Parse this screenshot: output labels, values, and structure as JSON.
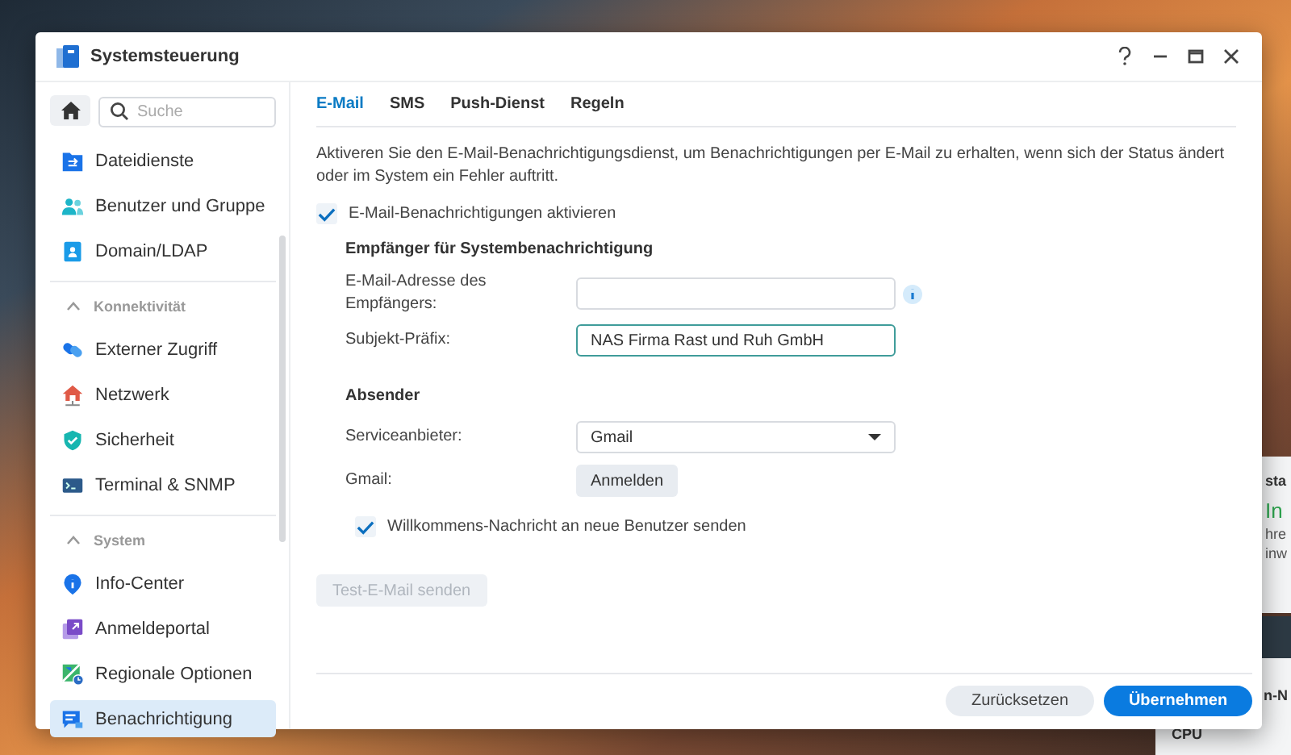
{
  "window": {
    "title": "Systemsteuerung"
  },
  "sidebar": {
    "search": {
      "placeholder": "Suche"
    },
    "groups": [
      {
        "items": [
          {
            "label": "Dateidienste",
            "selected": false
          },
          {
            "label": "Benutzer und Gruppe",
            "selected": false
          },
          {
            "label": "Domain/LDAP",
            "selected": false
          }
        ]
      },
      {
        "title": "Konnektivität",
        "expanded": true,
        "items": [
          {
            "label": "Externer Zugriff",
            "selected": false
          },
          {
            "label": "Netzwerk",
            "selected": false
          },
          {
            "label": "Sicherheit",
            "selected": false
          },
          {
            "label": "Terminal & SNMP",
            "selected": false
          }
        ]
      },
      {
        "title": "System",
        "expanded": true,
        "items": [
          {
            "label": "Info-Center",
            "selected": false
          },
          {
            "label": "Anmeldeportal",
            "selected": false
          },
          {
            "label": "Regionale Optionen",
            "selected": false
          },
          {
            "label": "Benachrichtigung",
            "selected": true
          }
        ]
      }
    ]
  },
  "tabs": [
    {
      "label": "E-Mail",
      "selected": true
    },
    {
      "label": "SMS",
      "selected": false
    },
    {
      "label": "Push-Dienst",
      "selected": false
    },
    {
      "label": "Regeln",
      "selected": false
    }
  ],
  "description": "Aktiveren Sie den E-Mail-Benachrichtigungsdienst, um Benachrichtigungen per E-Mail zu erhalten, wenn sich der Status ändert oder im System ein Fehler auftritt.",
  "enable_checkbox": {
    "label": "E-Mail-Benachrichtigungen aktivieren",
    "checked": true
  },
  "sections": [
    {
      "title": "Empfänger für Systembenachrichtigung",
      "rows": [
        {
          "kind": "text",
          "label": "E-Mail-Adresse des Empfängers:",
          "info_icon": true,
          "focused": false
        },
        {
          "kind": "text",
          "label": "Subjekt-Präfix:",
          "value": "NAS Firma Rast und Ruh GmbH",
          "info_icon": false,
          "focused": true
        }
      ]
    },
    {
      "title": "Absender",
      "rows": [
        {
          "kind": "select",
          "label": "Serviceanbieter:",
          "value": "Gmail"
        },
        {
          "kind": "button",
          "label": "Gmail:",
          "button": "Anmelden"
        },
        {
          "kind": "checkbox",
          "label": "Willkommens-Nachricht an neue Benutzer senden",
          "checked": true
        }
      ]
    }
  ],
  "test_button": {
    "label": "Test-E-Mail senden",
    "disabled": true
  },
  "footer": {
    "buttons": [
      {
        "label": "Zurücksetzen",
        "kind": "secondary"
      },
      {
        "label": "Übernehmen",
        "kind": "primary"
      }
    ]
  },
  "desktop_widgets": [
    {
      "title": "sta",
      "status": "In",
      "lines": [
        "hre",
        "inw"
      ]
    },
    {
      "title": "n-N",
      "lines": [
        "CPU"
      ]
    }
  ]
}
